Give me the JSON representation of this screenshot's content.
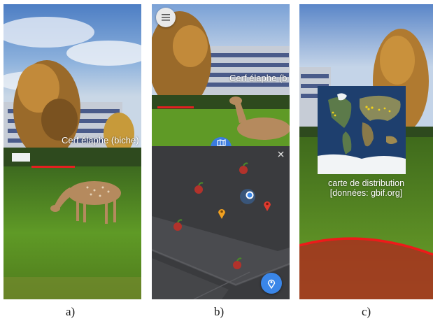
{
  "panel_a": {
    "ar_label": "Cerf élaphe (biche)",
    "caption": "a)"
  },
  "panel_b": {
    "ar_label": "Cerf élaphe (b",
    "caption": "b)",
    "menu_icon": "menu-icon",
    "map_tab_icon": "map-icon",
    "close_icon": "close-icon",
    "location_icon": "location-pin-icon",
    "colors": {
      "map_bg": "#3a3b3e",
      "accent": "#3a86e8",
      "pin_red": "#e03a2e",
      "pin_orange": "#f0a020"
    }
  },
  "panel_c": {
    "map_label_line1": "carte de distribution",
    "map_label_line2": "[données: gbif.org]",
    "caption": "c)"
  }
}
